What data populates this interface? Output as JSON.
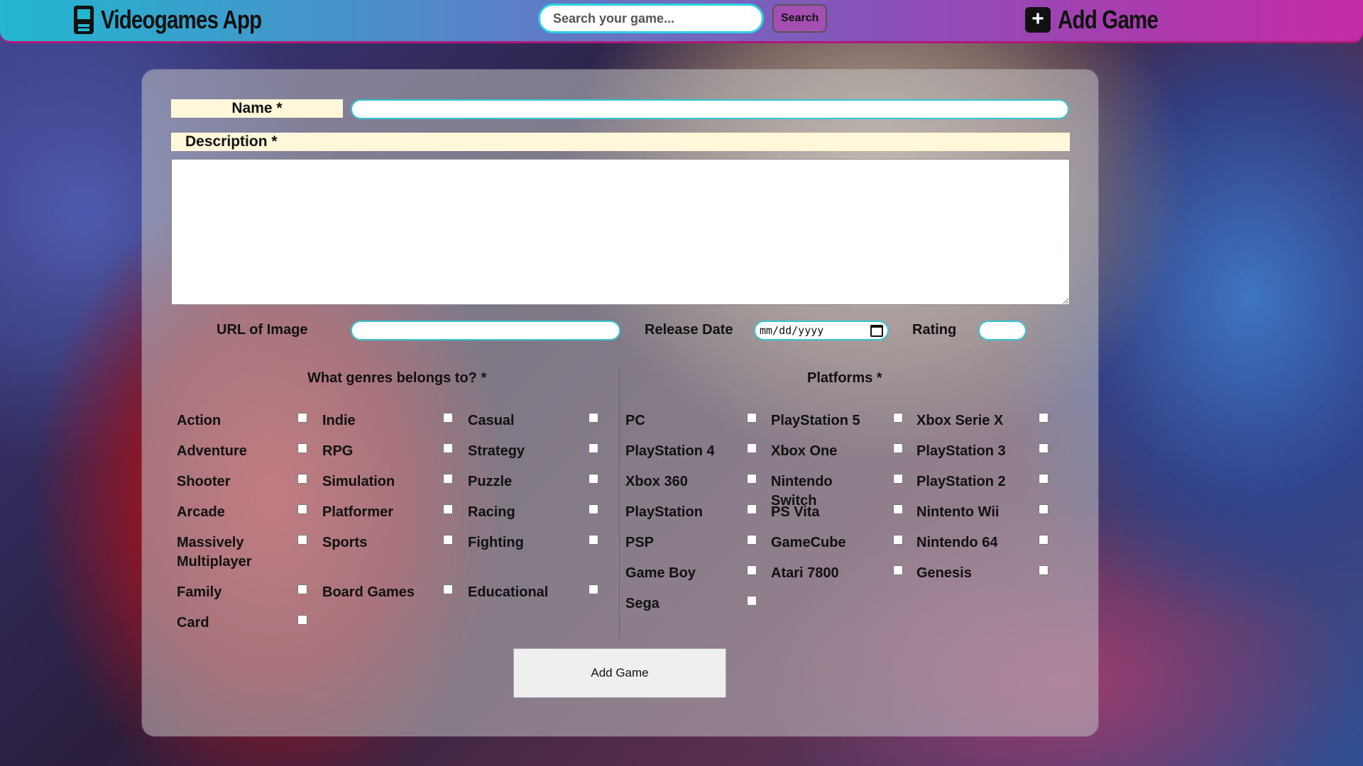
{
  "navbar": {
    "brand_title": "Videogames App",
    "search_placeholder": "Search your game...",
    "search_button": "Search",
    "add_game_label": "Add Game"
  },
  "form": {
    "name_label": "Name *",
    "description_label": "Description *",
    "url_label": "URL of Image",
    "release_label": "Release Date",
    "date_placeholder": "mm/dd/yyyy",
    "rating_label": "Rating",
    "genres_title": "What genres belongs to? *",
    "platforms_title": "Platforms *",
    "genres": [
      "Action",
      "Indie",
      "Casual",
      "Adventure",
      "RPG",
      "Strategy",
      "Shooter",
      "Simulation",
      "Puzzle",
      "Arcade",
      "Platformer",
      "Racing",
      "Massively Multiplayer",
      "Sports",
      "Fighting",
      "Family",
      "Board Games",
      "Educational",
      "Card"
    ],
    "platforms": [
      "PC",
      "PlayStation 5",
      "Xbox Serie X",
      "PlayStation 4",
      "Xbox One",
      "PlayStation 3",
      "Xbox 360",
      "Nintendo Switch",
      "PlayStation 2",
      "PlayStation",
      "PS Vita",
      "Nintento Wii",
      "PSP",
      "GameCube",
      "Nintendo 64",
      "Game Boy",
      "Atari 7800",
      "Genesis",
      "Sega"
    ],
    "submit_label": "Add Game"
  },
  "icons": {
    "brand": "gameboy-icon",
    "add": "plus-icon",
    "date": "calendar-icon"
  },
  "colors": {
    "accent_cyan": "#22b6d0",
    "accent_magenta": "#c42aa6",
    "label_bg": "#fff7d9"
  }
}
